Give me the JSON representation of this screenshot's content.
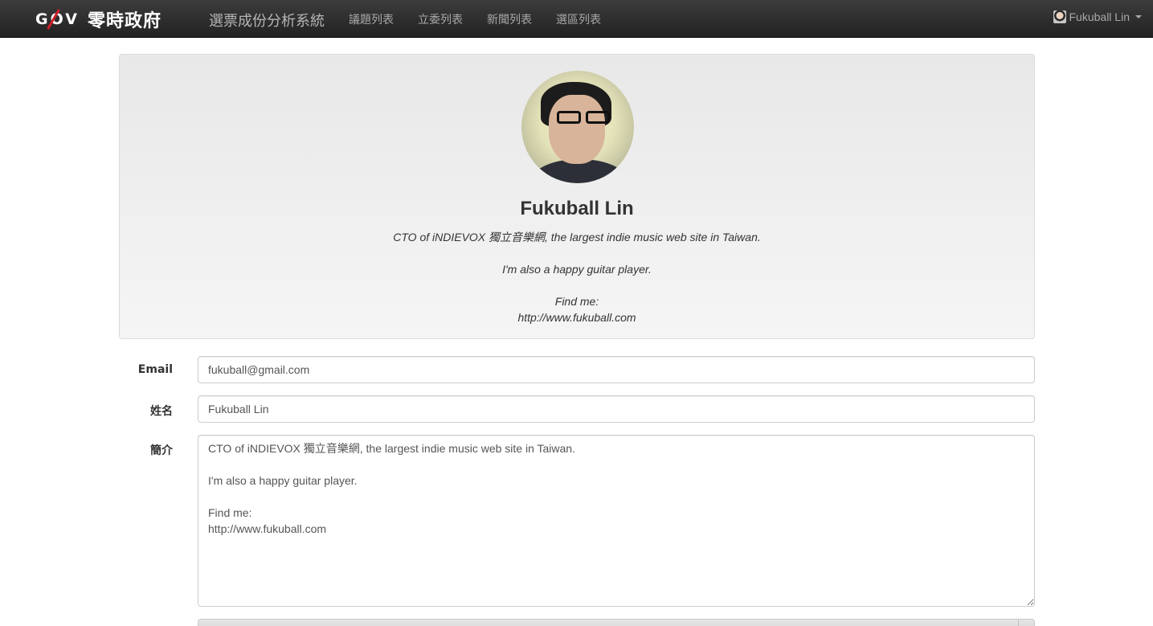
{
  "navbar": {
    "brand_gov": "GOV",
    "brand_cn": "零時政府",
    "app_title": "選票成份分析系統",
    "links": [
      "議題列表",
      "立委列表",
      "新聞列表",
      "選區列表"
    ],
    "user_name": "Fukuball Lin"
  },
  "profile": {
    "name": "Fukuball Lin",
    "bio_line1": "CTO of iNDIEVOX 獨立音樂網, the largest indie music web site in Taiwan.",
    "bio_line2": "I'm also a happy guitar player.",
    "bio_line3": "Find me:",
    "bio_line4": "http://www.fukuball.com"
  },
  "form": {
    "email_label": "Email",
    "email_value": "fukuball@gmail.com",
    "name_label": "姓名",
    "name_value": "Fukuball Lin",
    "bio_label": "簡介",
    "bio_value": "CTO of iNDIEVOX 獨立音樂網, the largest indie music web site in Taiwan.\n\nI'm also a happy guitar player.\n\nFind me:\nhttp://www.fukuball.com"
  }
}
